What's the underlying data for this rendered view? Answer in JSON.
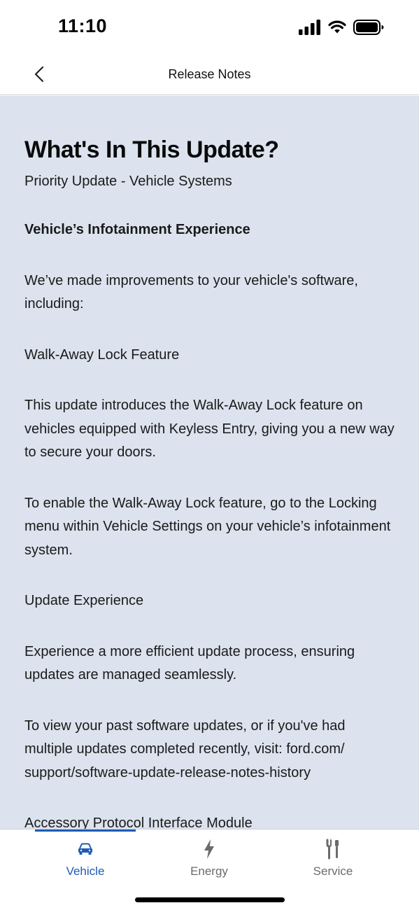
{
  "status_bar": {
    "time": "11:10"
  },
  "nav": {
    "title": "Release Notes"
  },
  "content": {
    "heading": "What's In This Update?",
    "subheading": "Priority Update - Vehicle Systems",
    "paragraphs": [
      {
        "text": "Vehicle’s Infotainment Experience",
        "bold": true
      },
      {
        "text": "We’ve made improvements to your vehicle's software, including:",
        "bold": false
      },
      {
        "text": "Walk-Away Lock Feature",
        "bold": false
      },
      {
        "text": "This update introduces the Walk-Away Lock feature on vehicles equipped with Keyless Entry, giving you a new way to secure your doors.",
        "bold": false
      },
      {
        "text": "To enable the Walk-Away Lock feature, go to the Locking menu within Vehicle Settings on your vehicle’s infotainment system.",
        "bold": false
      },
      {
        "text": "Update Experience",
        "bold": false
      },
      {
        "text": "Experience a more efficient update process, ensuring updates are managed seamlessly.",
        "bold": false
      },
      {
        "text": "To view your past software updates, or if you've had multiple updates completed recently, visit: ford.com/ support/software-update-release-notes-history",
        "bold": false
      },
      {
        "text": "Accessory Protocol Interface Module",
        "bold": false
      }
    ]
  },
  "tabs": [
    {
      "label": "Vehicle",
      "icon": "car-icon",
      "active": true
    },
    {
      "label": "Energy",
      "icon": "lightning-icon",
      "active": false
    },
    {
      "label": "Service",
      "icon": "tools-icon",
      "active": false
    }
  ],
  "colors": {
    "content_background": "#dce3ee",
    "accent": "#1f5bb6",
    "inactive_tab": "#6b6b6b"
  }
}
